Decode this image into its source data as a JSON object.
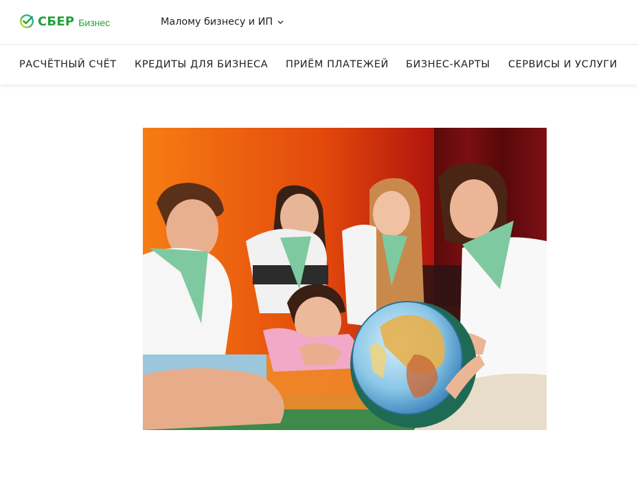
{
  "header": {
    "logo": {
      "brand": "СБЕР",
      "product": "Бизнес",
      "brand_color": "#21a038"
    },
    "segment": {
      "label": "Малому бизнесу и ИП",
      "icon": "chevron-down-icon"
    }
  },
  "nav": {
    "items": [
      {
        "label": "Расчётный счёт"
      },
      {
        "label": "Кредиты для бизнеса"
      },
      {
        "label": "Приём платежей"
      },
      {
        "label": "Бизнес-карты"
      },
      {
        "label": "Сервисы и услуги"
      }
    ]
  },
  "hero": {
    "image": "photo of children and a teacher with a globe"
  }
}
